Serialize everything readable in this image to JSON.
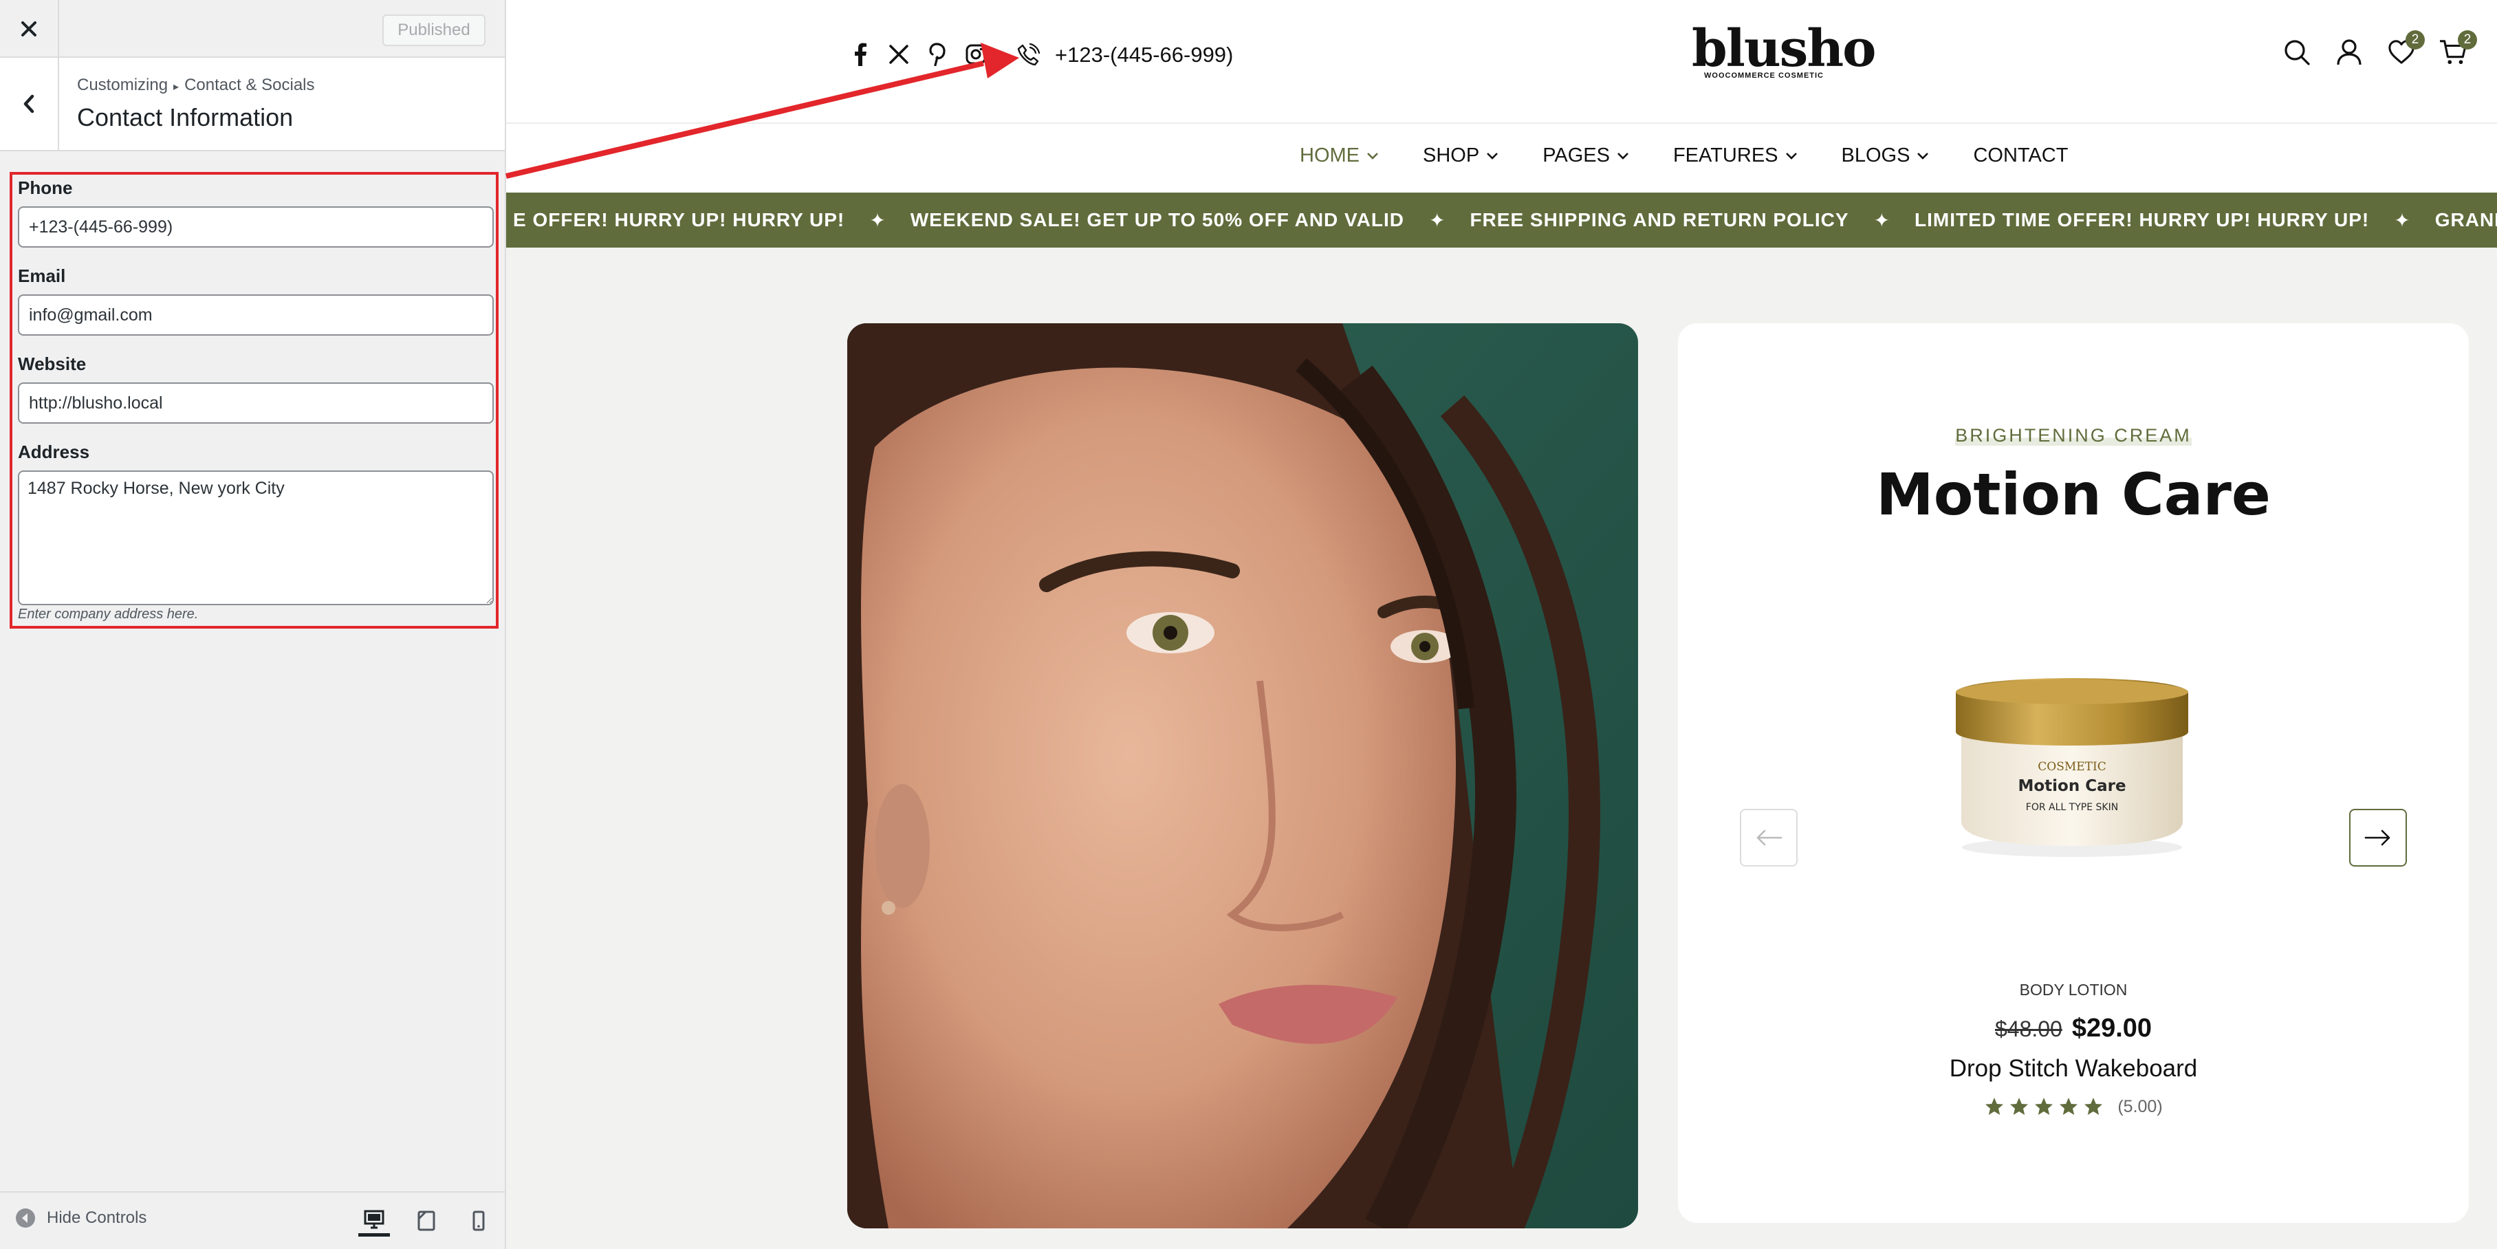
{
  "customizer": {
    "publish_label": "Published",
    "breadcrumb": {
      "root": "Customizing",
      "section": "Contact & Socials"
    },
    "panel_title": "Contact Information",
    "fields": {
      "phone": {
        "label": "Phone",
        "value": "+123-(445-66-999)"
      },
      "email": {
        "label": "Email",
        "value": "info@gmail.com"
      },
      "website": {
        "label": "Website",
        "value": "http://blusho.local"
      },
      "address": {
        "label": "Address",
        "value": "1487 Rocky Horse, New york City",
        "description": "Enter company address here."
      }
    },
    "footer": {
      "hide_controls": "Hide Controls",
      "devices": [
        "desktop-icon",
        "tablet-icon",
        "mobile-icon"
      ],
      "active_device": "desktop"
    }
  },
  "site": {
    "phone": "+123-(445-66-999)",
    "socials": [
      "facebook-icon",
      "x-icon",
      "pinterest-icon",
      "instagram-icon"
    ],
    "logo": {
      "word": "blusho",
      "tagline": "WOOCOMMERCE COSMETIC"
    },
    "header_counts": {
      "wishlist": "2",
      "cart": "2"
    },
    "nav": [
      "HOME",
      "SHOP",
      "PAGES",
      "FEATURES",
      "BLOGS",
      "CONTACT"
    ],
    "marquee": [
      "E OFFER! HURRY UP! HURRY UP!",
      "WEEKEND SALE! GET UP TO 50% OFF AND VALID",
      "FREE SHIPPING AND RETURN POLICY",
      "LIMITED TIME OFFER! HURRY UP! HURRY UP!",
      "GRAND OPENING OFF"
    ],
    "card": {
      "kicker": "BRIGHTENING CREAM",
      "title": "Motion Care",
      "jar_label": {
        "line1": "COSMETIC",
        "line2": "Motion Care",
        "line3": "FOR ALL TYPE SKIN"
      },
      "category": "BODY LOTION",
      "price_old": "$48.00",
      "price_new": "$29.00",
      "name": "Drop Stitch Wakeboard",
      "rating": "(5.00)",
      "stars": 5
    }
  },
  "colors": {
    "accent": "#606c3c",
    "annotation": "#e2262b"
  }
}
